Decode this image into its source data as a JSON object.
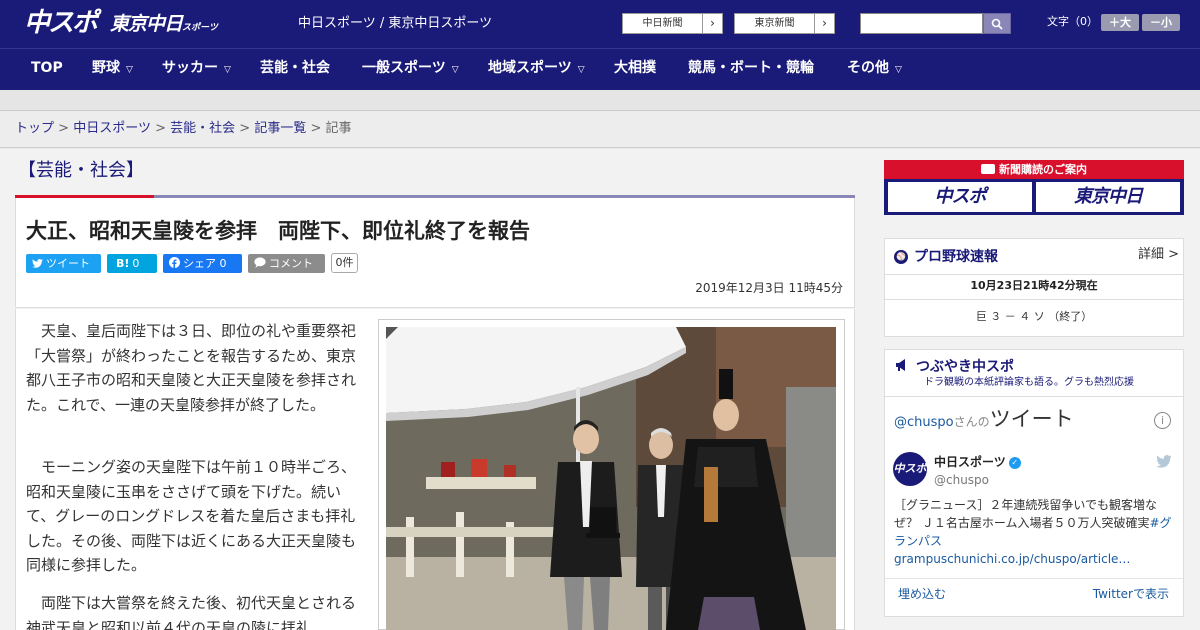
{
  "header": {
    "logo_chunichi": "中スポ",
    "logo_tokyo": "東京中日",
    "logo_tokyo_sub": "スポーツ",
    "site_names": "中日スポーツ / 東京中日スポーツ",
    "btn_chunichi_shimbun": "中日新聞",
    "btn_tokyo_shimbun": "東京新聞",
    "search_placeholder": "",
    "font_size_label": "文字（0）",
    "font_bigger": "＋大",
    "font_smaller": "－小"
  },
  "nav": {
    "items": [
      "TOP",
      "野球",
      "サッカー",
      "芸能・社会",
      "一般スポーツ",
      "地域スポーツ",
      "大相撲",
      "競馬・ボート・競輪",
      "その他"
    ]
  },
  "breadcrumb": {
    "items": [
      "トップ",
      "中日スポーツ",
      "芸能・社会",
      "記事一覧"
    ],
    "current": "記事",
    "separator": ">"
  },
  "article": {
    "section": "【芸能・社会】",
    "headline": "大正、昭和天皇陵を参拝　両陛下、即位礼終了を報告",
    "share": {
      "tweet": "ツイート",
      "hatena": "B!",
      "hatena_count": "0",
      "facebook": "シェア",
      "facebook_count": "0",
      "comment": "コメント",
      "comment_count": "0件"
    },
    "date": "2019年12月3日 11時45分",
    "paragraphs": [
      "天皇、皇后両陛下は３日、即位の礼や重要祭祀「大嘗祭」が終わったことを報告するため、東京都八王子市の昭和天皇陵と大正天皇陵を参拝された。これで、一連の天皇陵参拝が終了した。",
      "モーニング姿の天皇陛下は午前１０時半ごろ、昭和天皇陵に玉串をささげて頭を下げた。続いて、グレーのロングドレスを着た皇后さまも拝礼した。その後、両陛下は近くにある大正天皇陵も同様に参拝した。",
      "両陛下は大嘗祭を終えた後、初代天皇とされる神武天皇と昭和以前４代の天皇の陵に拝礼"
    ]
  },
  "sidebar": {
    "ad_title": "新聞購読のご案内",
    "ad_logo_1": "中スポ",
    "ad_logo_2": "東京中日",
    "baseball": {
      "title": "プロ野球速報",
      "detail": "詳細 >",
      "as_of": "10月23日21時42分現在",
      "score": "巨 ３ － ４ ソ （終了）"
    },
    "tweets": {
      "title": "つぶやき中スポ",
      "subtitle": "ドラ観戦の本紙評論家も語る。グラも熱烈応援",
      "handle": "@chuspo",
      "handle_suffix": "さんの",
      "heading": "ツイート",
      "account_name": "中日スポーツ",
      "account_at": "@chuspo",
      "avatar_text": "中スポ",
      "tweet_text": "［グラニュース］２年連続残留争いでも観客増なぜ？ Ｊ１名古屋ホーム入場者５０万人突破確実",
      "tweet_hashtag": "#グランパス",
      "tweet_link": "grampuschunichi.co.jp/chuspo/article…",
      "embed": "埋め込む",
      "view_on_twitter": "Twitterで表示"
    }
  },
  "colors": {
    "brand_navy": "#1a1a78",
    "accent_red": "#d8102c",
    "twitter": "#1da1f2",
    "hatena": "#00a4de",
    "facebook": "#1877f2",
    "comment": "#8c8c8c"
  }
}
